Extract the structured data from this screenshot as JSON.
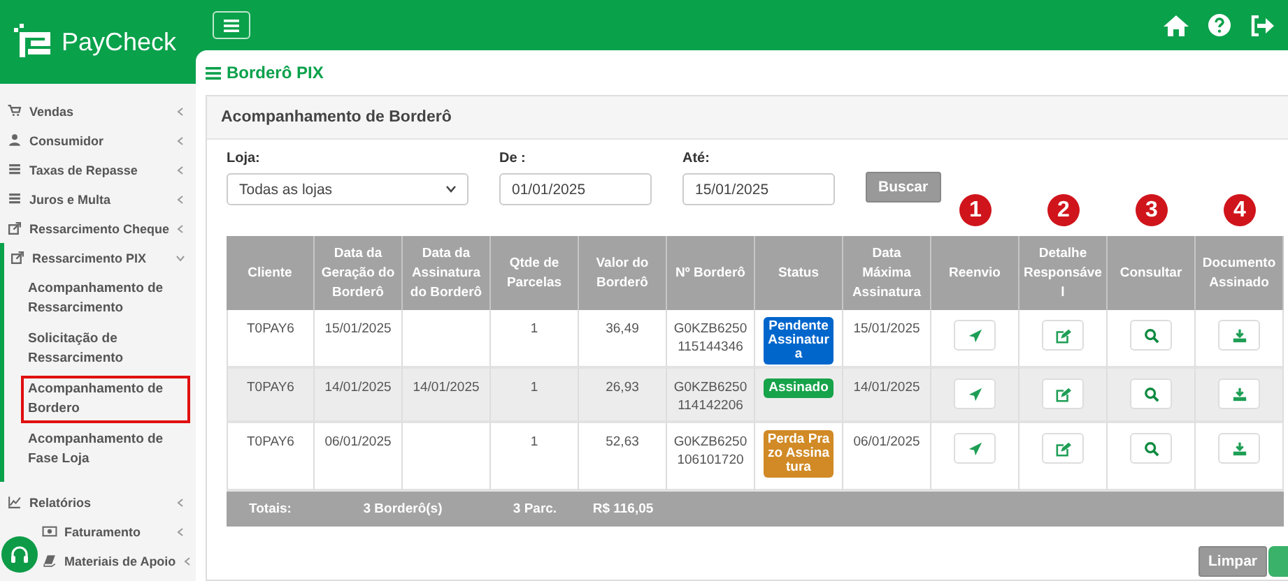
{
  "logo": {
    "text": "PayCheck"
  },
  "sidebar": {
    "items": [
      {
        "label": "Vendas",
        "kind": "cart",
        "expanded": false
      },
      {
        "label": "Consumidor",
        "kind": "user",
        "expanded": false
      },
      {
        "label": "Taxas de Repasse",
        "kind": "list",
        "expanded": false
      },
      {
        "label": "Juros e Multa",
        "kind": "list",
        "expanded": false
      },
      {
        "label": "Ressarcimento Cheque",
        "kind": "share",
        "expanded": false
      },
      {
        "label": "Ressarcimento PIX",
        "kind": "share",
        "expanded": true,
        "children": [
          {
            "label": "Acompanhamento de Ressarcimento",
            "selected": false
          },
          {
            "label": "Solicitação de Ressarcimento",
            "selected": false
          },
          {
            "label": "Acompanhamento de Bordero",
            "selected": true
          },
          {
            "label": "Acompanhamento de Fase Loja",
            "selected": false
          }
        ]
      },
      {
        "label": "Relatórios",
        "kind": "chart",
        "expanded": false
      },
      {
        "label": "Faturamento",
        "kind": "money",
        "expanded": false
      },
      {
        "label": "Materiais de Apoio",
        "kind": "book",
        "expanded": false
      }
    ]
  },
  "page_title": "Borderô PIX",
  "card": {
    "title": "Acompanhamento de Borderô"
  },
  "filters": [
    {
      "label": "Loja:",
      "value": "Todas as lojas",
      "kind": "select"
    },
    {
      "label": "De :",
      "value": "01/01/2025",
      "kind": "input"
    },
    {
      "label": "Até:",
      "value": "15/01/2025",
      "kind": "input"
    }
  ],
  "search_button": "Buscar",
  "markers": [
    "1",
    "2",
    "3",
    "4"
  ],
  "table": {
    "columns": [
      "Cliente",
      "Data da Geração do Borderô",
      "Data da Assinatura do Borderô",
      "Qtde de Parcelas",
      "Valor do Borderô",
      "Nº Borderô",
      "Status",
      "Data Máxima Assinatura",
      "Reenvio",
      "Detalhe Responsável",
      "Consultar",
      "Documento Assinado"
    ],
    "rows": [
      {
        "cliente": "T0PAY6",
        "geracao": "15/01/2025",
        "parcelas": "1",
        "valor": "36,49",
        "numero": "G0KZB6250115144346",
        "status": {
          "label": "Pendente Assinatura",
          "color": "#0066cc"
        },
        "data_maxima": "15/01/2025"
      },
      {
        "cliente": "T0PAY6",
        "geracao": "14/01/2025",
        "assinatura": "14/01/2025",
        "parcelas": "1",
        "valor": "26,93",
        "numero": "G0KZB6250114142206",
        "status": {
          "label": "Assinado",
          "color": "#17a34a"
        },
        "data_maxima": "14/01/2025"
      },
      {
        "cliente": "T0PAY6",
        "geracao": "06/01/2025",
        "parcelas": "1",
        "valor": "52,63",
        "numero": "G0KZB6250106101720",
        "status": {
          "label": "Perda Prazo Assinatura",
          "color": "#d18a25"
        },
        "data_maxima": "06/01/2025"
      }
    ],
    "totals": [
      "Totais:",
      "3 Borderô(s)",
      "3 Parc.",
      "R$ 116,05"
    ]
  },
  "clear_button": "Limpar"
}
